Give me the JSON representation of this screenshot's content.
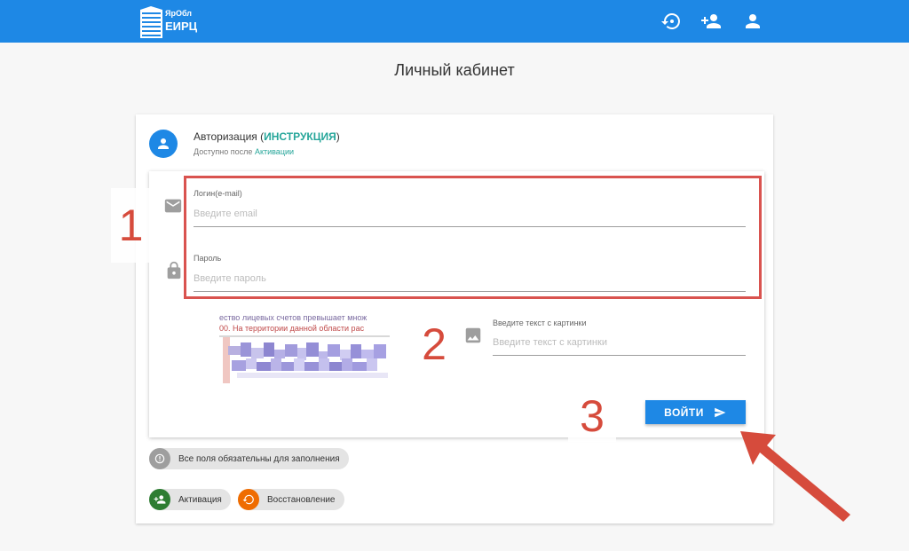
{
  "header": {
    "logo_line1": "ЯрОбл",
    "logo_line2": "ЕИРЦ",
    "icons": [
      "restore-icon",
      "add-user-icon",
      "user-icon"
    ]
  },
  "page_title": "Личный кабинет",
  "auth": {
    "title": "Авторизация",
    "paren_open": "(",
    "instruction_link": "ИНСТРУКЦИЯ",
    "paren_close": ")",
    "subtitle": "Доступно после",
    "activation_link": "Активации"
  },
  "form": {
    "login_label": "Логин(e-mail)",
    "login_placeholder": "Введите email",
    "password_label": "Пароль",
    "password_placeholder": "Введите пароль",
    "captcha_label": "Введите текст с картинки",
    "captcha_placeholder": "Введите текст с картинки",
    "captcha_line1": "ество лицевых счетов превышает множ",
    "captcha_line2": "00. На территории данной области рас",
    "submit_label": "ВОЙТИ"
  },
  "steps": [
    "1",
    "2",
    "3"
  ],
  "chips": {
    "required_note": "Все поля обязательны для заполнения",
    "activation": "Активация",
    "recovery": "Восстановление"
  },
  "colors": {
    "primary": "#1e88e5",
    "accent_link": "#26a69a",
    "annotation_red": "#d64b3c",
    "activation_chip": "#2e7d32",
    "recovery_chip": "#ef6c00",
    "required_chip": "#9e9e9e"
  }
}
